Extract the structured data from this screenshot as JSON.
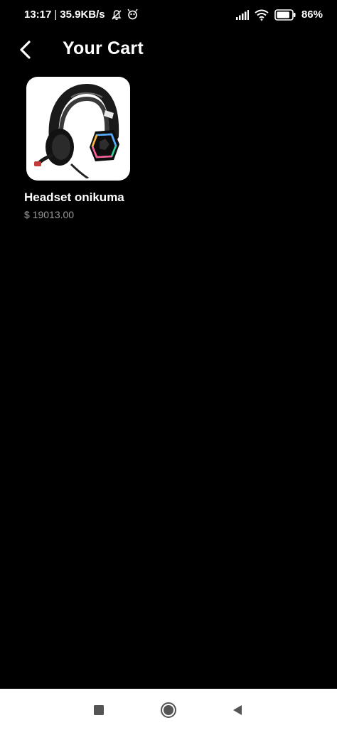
{
  "status_bar": {
    "time": "13:17",
    "separator": "|",
    "network_speed": "35.9KB/s",
    "battery_percent": "86%",
    "icons": [
      "muted-bell-icon",
      "app-notification-icon",
      "signal-icon",
      "wifi-icon",
      "battery-icon"
    ]
  },
  "header": {
    "title": "Your Cart",
    "back_icon": "chevron-left-icon"
  },
  "cart": {
    "items": [
      {
        "name": "Headset onikuma",
        "price": "$ 19013.00",
        "image": "headset-image"
      }
    ]
  },
  "nav_bar": {
    "icons": [
      "recent-apps-icon",
      "home-icon",
      "back-triangle-icon"
    ]
  },
  "colors": {
    "background": "#000000",
    "text": "#ffffff",
    "price_text": "#9a9a9a",
    "nav_bar": "#ffffff",
    "nav_icon": "#555555"
  }
}
